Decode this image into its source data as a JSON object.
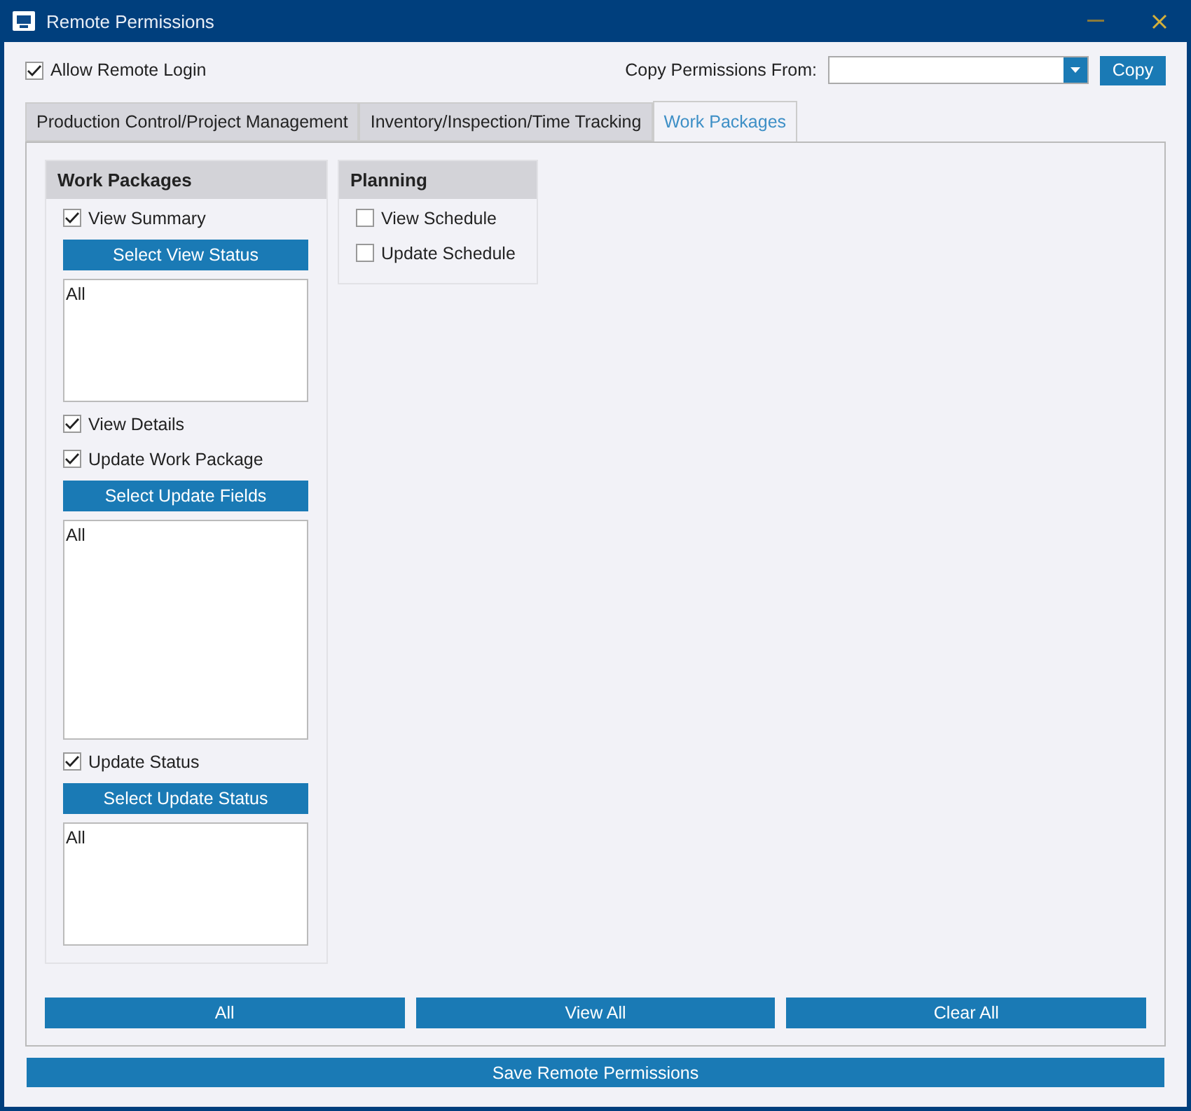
{
  "window": {
    "title": "Remote Permissions"
  },
  "allow_remote_login": {
    "label": "Allow Remote Login",
    "checked": true
  },
  "copy_from": {
    "label": "Copy Permissions From:",
    "button": "Copy"
  },
  "tabs": [
    {
      "label": "Production Control/Project Management",
      "selected": false
    },
    {
      "label": "Inventory/Inspection/Time Tracking",
      "selected": false
    },
    {
      "label": "Work Packages",
      "selected": true
    }
  ],
  "groups": [
    {
      "title": "Work Packages",
      "items": [
        {
          "kind": "checkbox",
          "label": "View Summary",
          "checked": true
        },
        {
          "kind": "button",
          "label": "Select View Status"
        },
        {
          "kind": "list",
          "items": [
            "All"
          ]
        },
        {
          "kind": "checkbox",
          "label": "View Details",
          "checked": true
        },
        {
          "kind": "checkbox",
          "label": "Update Work Package",
          "checked": true
        },
        {
          "kind": "button",
          "label": "Select Update Fields"
        },
        {
          "kind": "list",
          "items": [
            "All"
          ]
        },
        {
          "kind": "checkbox",
          "label": "Update Status",
          "checked": true
        },
        {
          "kind": "button",
          "label": "Select Update Status"
        },
        {
          "kind": "list",
          "items": [
            "All"
          ]
        }
      ]
    },
    {
      "title": "Planning",
      "items": [
        {
          "kind": "checkbox",
          "label": "View Schedule",
          "checked": false
        },
        {
          "kind": "checkbox",
          "label": "Update Schedule",
          "checked": false
        }
      ]
    }
  ],
  "bottom_buttons": [
    "All",
    "View All",
    "Clear All"
  ],
  "save_button": "Save Remote Permissions"
}
